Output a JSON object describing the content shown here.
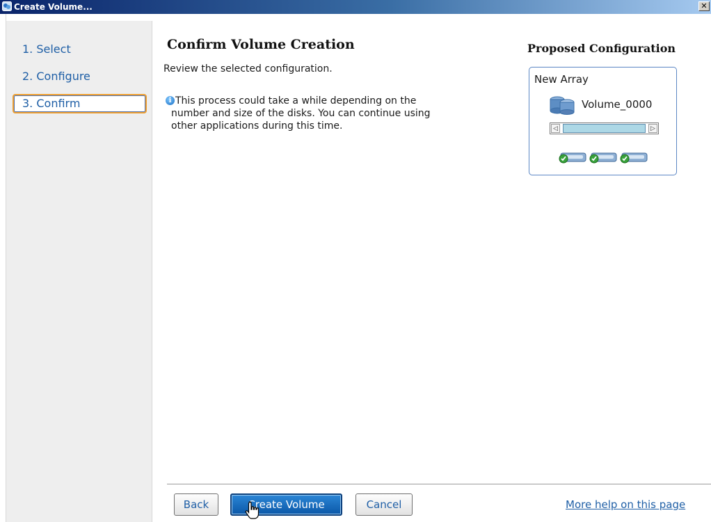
{
  "window": {
    "title": "Create Volume...",
    "close_glyph": "✕"
  },
  "sidebar": {
    "steps": [
      {
        "label": "1. Select",
        "active": false
      },
      {
        "label": "2. Configure",
        "active": false
      },
      {
        "label": "3. Confirm",
        "active": true
      }
    ]
  },
  "main": {
    "title": "Confirm Volume Creation",
    "subtitle": "Review the selected configuration.",
    "info_icon_glyph": "i",
    "info_lines": [
      "This process could take a while depending on the",
      "number and size of the disks. You can continue using",
      "other applications during this time."
    ]
  },
  "proposed": {
    "title": "Proposed Configuration",
    "array_label": "New Array",
    "volume_label": "Volume_0000",
    "slider_left_glyph": "◁",
    "slider_right_glyph": "▷",
    "disk_count": 3
  },
  "footer": {
    "back_label": "Back",
    "create_label": "Create Volume",
    "cancel_label": "Cancel",
    "help_link": "More help on this page"
  },
  "colors": {
    "accent": "#1f5fa6",
    "active_step_border": "#f0a030",
    "primary_button": "#0b58a8",
    "volume_fill": "#add8e6"
  },
  "icons": {
    "app": "app-icon",
    "info": "info-icon",
    "volume": "database-volume-icon",
    "disk": "disk-ok-icon",
    "cursor": "hand-pointer-icon"
  }
}
